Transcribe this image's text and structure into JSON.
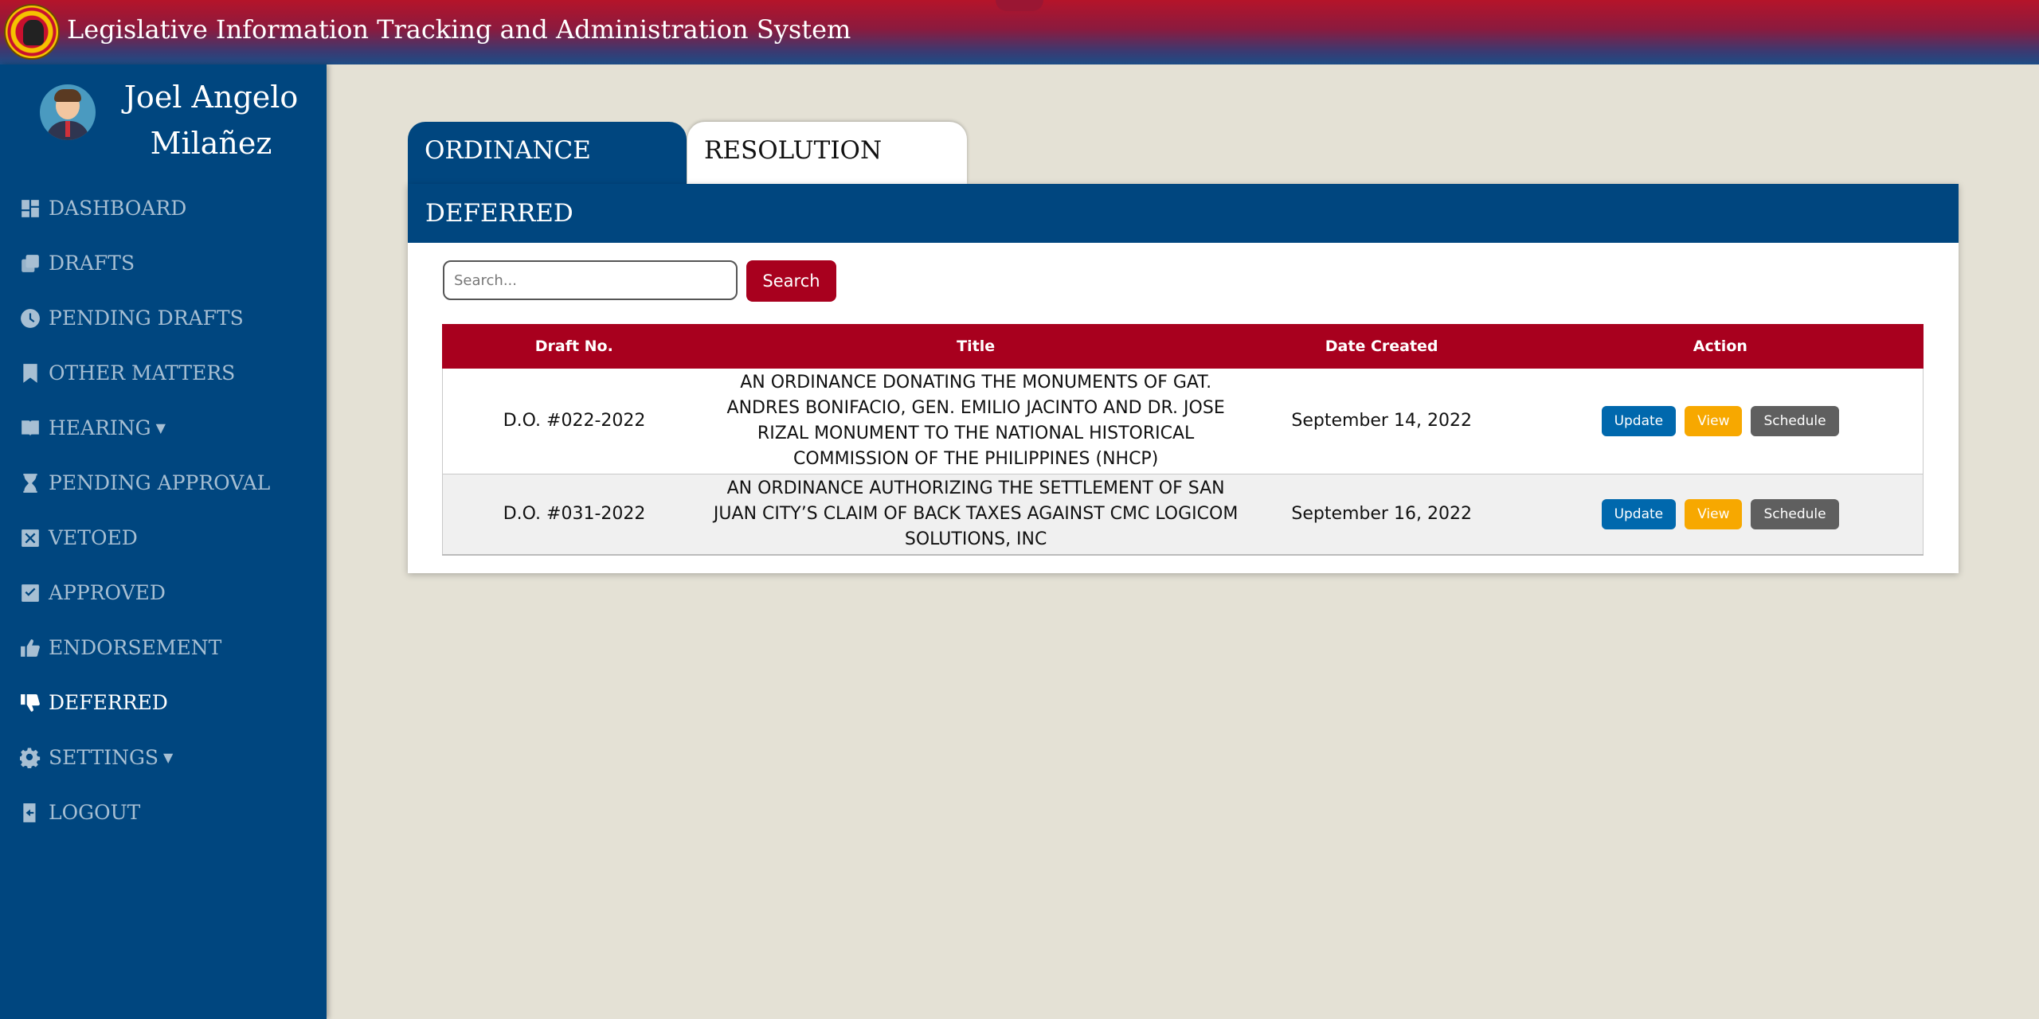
{
  "header": {
    "title": "Legislative Information Tracking and Administration System"
  },
  "user": {
    "name": "Joel Angelo Milañez"
  },
  "sidebar": {
    "items": [
      {
        "label": "DASHBOARD",
        "icon": "dashboard-icon"
      },
      {
        "label": "DRAFTS",
        "icon": "copy-icon"
      },
      {
        "label": "PENDING DRAFTS",
        "icon": "clock-icon"
      },
      {
        "label": "OTHER MATTERS",
        "icon": "bookmark-icon"
      },
      {
        "label": "HEARING",
        "icon": "book-icon",
        "dropdown": true
      },
      {
        "label": "PENDING APPROVAL",
        "icon": "hourglass-icon"
      },
      {
        "label": "VETOED",
        "icon": "x-square-icon"
      },
      {
        "label": "APPROVED",
        "icon": "check-square-icon"
      },
      {
        "label": "ENDORSEMENT",
        "icon": "thumbs-up-icon"
      },
      {
        "label": "DEFERRED",
        "icon": "thumbs-down-icon",
        "active": true
      },
      {
        "label": "SETTINGS",
        "icon": "gear-icon",
        "dropdown": true
      },
      {
        "label": "LOGOUT",
        "icon": "logout-icon"
      }
    ]
  },
  "tabs": {
    "ordinance": "ORDINANCE",
    "resolution": "RESOLUTION"
  },
  "panel": {
    "title": "DEFERRED"
  },
  "search": {
    "placeholder": "Search...",
    "button": "Search"
  },
  "table": {
    "headers": [
      "Draft No.",
      "Title",
      "Date Created",
      "Action"
    ],
    "rows": [
      {
        "draft_no": "D.O. #022-2022",
        "title": "AN ORDINANCE DONATING THE MONUMENTS OF GAT. ANDRES BONIFACIO, GEN. EMILIO JACINTO AND DR. JOSE RIZAL MONUMENT TO THE NATIONAL HISTORICAL COMMISSION OF THE PHILIPPINES (NHCP)",
        "date": "September 14, 2022"
      },
      {
        "draft_no": "D.O. #031-2022",
        "title": "AN ORDINANCE AUTHORIZING THE SETTLEMENT OF SAN JUAN CITY’S CLAIM OF BACK TAXES AGAINST CMC LOGICOM SOLUTIONS, INC",
        "date": "September 16, 2022"
      }
    ],
    "actions": {
      "update": "Update",
      "view": "View",
      "schedule": "Schedule"
    }
  },
  "colors": {
    "sidebar": "#00467f",
    "accent_red": "#a8001e",
    "update_button": "#0068ad",
    "view_button": "#f7a800",
    "schedule_button": "#5f5f5f",
    "background": "#e4e1d5"
  }
}
